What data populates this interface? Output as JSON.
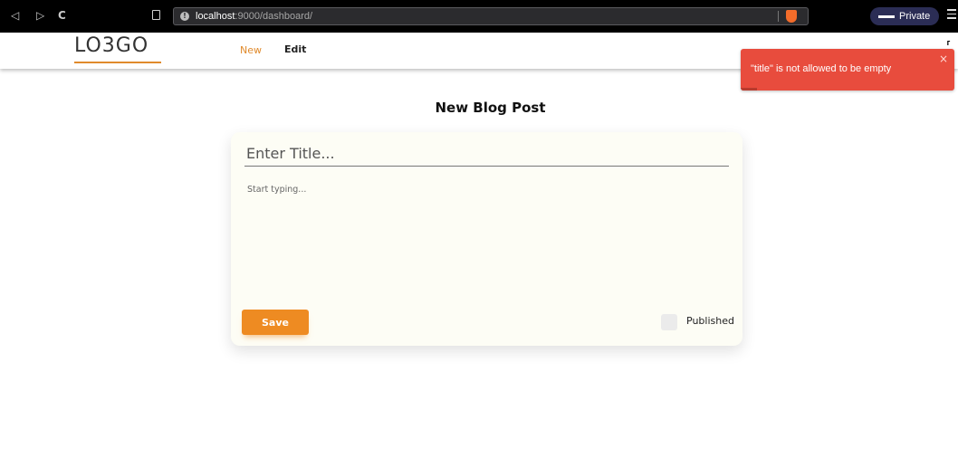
{
  "browser": {
    "back_icon": "back-arrow-icon",
    "forward_icon": "forward-arrow-icon",
    "reload_icon": "reload-icon",
    "url_host": "localhost",
    "url_rest": ":9000/dashboard/",
    "private_label": "Private"
  },
  "header": {
    "logo": "LO3GO",
    "nav_new": "New",
    "nav_edit": "Edit",
    "accent_color": "#e08a2c"
  },
  "toast": {
    "message": "\"title\" is not allowed to be empty",
    "close": "×",
    "color": "#e84c3d"
  },
  "page": {
    "title": "New Blog Post"
  },
  "form": {
    "title_placeholder": "Enter Title...",
    "title_value": "",
    "body_placeholder": "Start typing...",
    "body_value": "",
    "save_label": "Save",
    "published_label": "Published",
    "published_checked": false
  }
}
